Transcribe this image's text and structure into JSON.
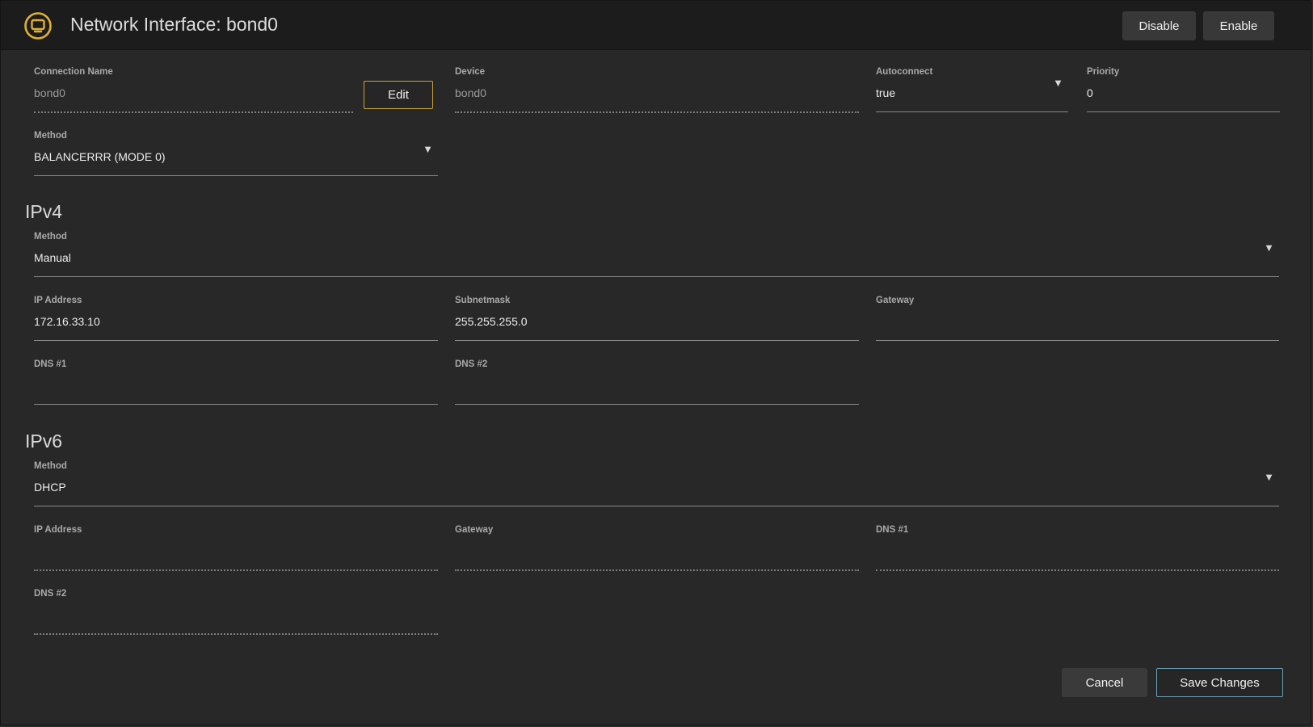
{
  "header": {
    "title": "Network Interface: bond0",
    "disable_label": "Disable",
    "enable_label": "Enable",
    "icon": "network-interface-icon"
  },
  "general": {
    "connection_name": {
      "label": "Connection Name",
      "value": "bond0"
    },
    "edit_label": "Edit",
    "device": {
      "label": "Device",
      "value": "bond0"
    },
    "autoconnect": {
      "label": "Autoconnect",
      "value": "true"
    },
    "priority": {
      "label": "Priority",
      "value": "0"
    },
    "method": {
      "label": "Method",
      "value": "BALANCERRR (MODE 0)"
    }
  },
  "ipv4": {
    "heading": "IPv4",
    "method": {
      "label": "Method",
      "value": "Manual"
    },
    "ip_address": {
      "label": "IP Address",
      "value": "172.16.33.10"
    },
    "subnetmask": {
      "label": "Subnetmask",
      "value": "255.255.255.0"
    },
    "gateway": {
      "label": "Gateway",
      "value": ""
    },
    "dns1": {
      "label": "DNS #1",
      "value": ""
    },
    "dns2": {
      "label": "DNS #2",
      "value": ""
    }
  },
  "ipv6": {
    "heading": "IPv6",
    "method": {
      "label": "Method",
      "value": "DHCP"
    },
    "ip_address": {
      "label": "IP Address",
      "value": ""
    },
    "gateway": {
      "label": "Gateway",
      "value": ""
    },
    "dns1": {
      "label": "DNS #1",
      "value": ""
    },
    "dns2": {
      "label": "DNS #2",
      "value": ""
    }
  },
  "footer": {
    "cancel_label": "Cancel",
    "save_label": "Save Changes"
  },
  "colors": {
    "accent": "#c9a23a",
    "save_border": "#6aa0b4",
    "background": "#282828",
    "titlebar": "#1c1c1c"
  }
}
